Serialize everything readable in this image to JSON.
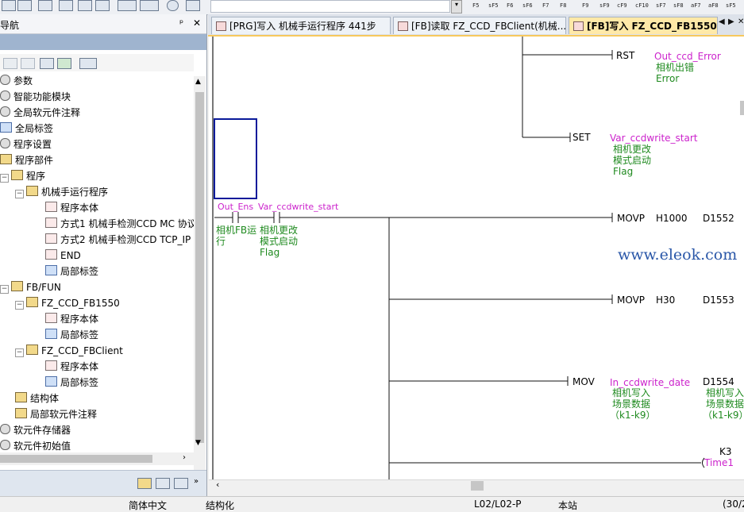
{
  "toolbar": {
    "fkeys": [
      "F5",
      "sF5",
      "F6",
      "sF6",
      "F7",
      "F8",
      "F9",
      "sF9",
      "cF9",
      "cF10",
      "sF7",
      "sF8",
      "aF7",
      "aF8",
      "sF5"
    ]
  },
  "nav": {
    "title": "导航",
    "pin_glyph": "ᵖ",
    "close_glyph": "✕",
    "tree": [
      {
        "label": "参数"
      },
      {
        "label": "智能功能模块"
      },
      {
        "label": "全局软元件注释"
      },
      {
        "label": "全局标签"
      },
      {
        "label": "程序设置"
      },
      {
        "label": "程序部件"
      },
      {
        "label": "程序"
      },
      {
        "label": "机械手运行程序"
      },
      {
        "label": "程序本体"
      },
      {
        "label": "方式1 机械手检测CCD  MC 协议"
      },
      {
        "label": "方式2  机械手检测CCD  TCP_IP"
      },
      {
        "label": "END"
      },
      {
        "label": "局部标签"
      },
      {
        "label": "FB/FUN"
      },
      {
        "label": "FZ_CCD_FB1550"
      },
      {
        "label": "程序本体"
      },
      {
        "label": "局部标签"
      },
      {
        "label": "FZ_CCD_FBClient"
      },
      {
        "label": "程序本体"
      },
      {
        "label": "局部标签"
      },
      {
        "label": "结构体"
      },
      {
        "label": "局部软元件注释"
      },
      {
        "label": "软元件存储器"
      },
      {
        "label": "软元件初始值"
      }
    ]
  },
  "tabs": [
    {
      "label": "[PRG]写入 机械手运行程序 441步"
    },
    {
      "label": "[FB]读取 FZ_CCD_FBClient(机械..."
    },
    {
      "label": "[FB]写入 FZ_CCD_FB1550 ..."
    }
  ],
  "tab_nav": {
    "prev": "◀",
    "next": "▶",
    "close": "✕"
  },
  "ladder": {
    "rst_instr": "RST",
    "rst_operand": "Out_ccd_Error",
    "rst_comment_1": "相机出错",
    "rst_comment_2": "Error",
    "set_instr": "SET",
    "set_operand": "Var_ccdwrite_start",
    "set_comment_1": "相机更改",
    "set_comment_2": "模式启动",
    "set_comment_3": "Flag",
    "contact1_label": "Out_Ens",
    "contact1_comment_1": "相机FB运",
    "contact1_comment_2": "行",
    "contact2_label": "Var_ccdwrite_start",
    "contact2_comment_1": "相机更改",
    "contact2_comment_2": "模式启动",
    "contact2_comment_3": "Flag",
    "movp1_instr": "MOVP",
    "movp1_src": "H1000",
    "movp1_dst": "D1552",
    "movp2_instr": "MOVP",
    "movp2_src": "H30",
    "movp2_dst": "D1553",
    "mov_instr": "MOV",
    "mov_src": "In_ccdwrite_date",
    "mov_dst": "D1554",
    "mov_src_comment_1": "相机写入",
    "mov_src_comment_2": "场景数据",
    "mov_src_comment_3": "（k1-k9）",
    "mov_dst_comment_1": "相机写入",
    "mov_dst_comment_2": "场景数据",
    "mov_dst_comment_3": "（k1-k9）",
    "timer_const": "K3",
    "timer_name": "Time1"
  },
  "watermark": "www.eleok.com",
  "status": {
    "lang": "简体中文",
    "mode": "结构化",
    "cpu": "L02/L02-P",
    "station": "本站",
    "pos": "(30/2"
  }
}
